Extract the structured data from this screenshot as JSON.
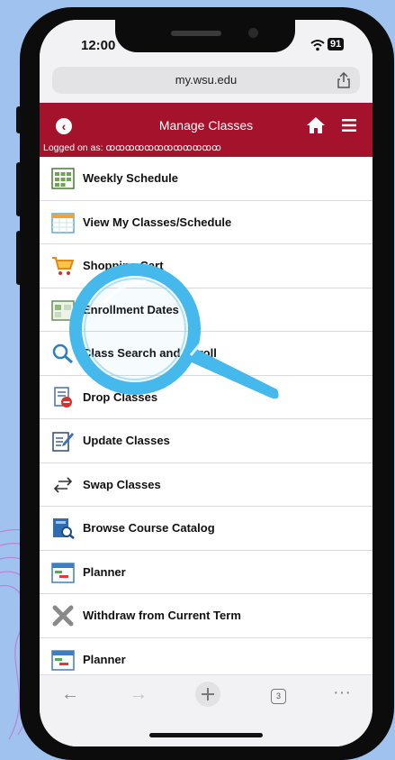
{
  "status": {
    "time": "12:00",
    "battery": "91"
  },
  "browser": {
    "url": "my.wsu.edu",
    "tab_count": "3"
  },
  "header": {
    "title": "Manage Classes",
    "logged_on": "Logged on as: ꝏꝏꝏꝏꝏꝏꝏꝏꝏꝏꝏꝏ"
  },
  "menu": {
    "items": [
      {
        "label": "Weekly Schedule",
        "icon": "weekly-schedule-icon"
      },
      {
        "label": "View My Classes/Schedule",
        "icon": "calendar-icon"
      },
      {
        "label": "Shopping Cart",
        "icon": "shopping-cart-icon"
      },
      {
        "label": "Enrollment Dates",
        "icon": "enrollment-dates-icon"
      },
      {
        "label": "Class Search and Enroll",
        "icon": "search-icon"
      },
      {
        "label": "Drop Classes",
        "icon": "drop-classes-icon"
      },
      {
        "label": "Update Classes",
        "icon": "update-classes-icon"
      },
      {
        "label": "Swap Classes",
        "icon": "swap-arrows-icon"
      },
      {
        "label": "Browse Course Catalog",
        "icon": "course-catalog-icon"
      },
      {
        "label": "Planner",
        "icon": "planner-icon"
      },
      {
        "label": "Withdraw from Current Term",
        "icon": "withdraw-x-icon"
      },
      {
        "label": "Planner",
        "icon": "planner-icon"
      }
    ]
  },
  "colors": {
    "header": "#a4122c",
    "magnifier": "#45b8ec",
    "background": "#9fc2ee"
  }
}
